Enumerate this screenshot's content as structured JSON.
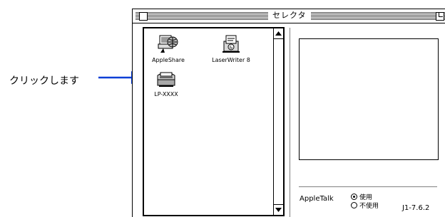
{
  "callout": {
    "text": "クリックします"
  },
  "window": {
    "title": "セレクタ",
    "devices": [
      {
        "label": "AppleShare",
        "icon": "appleshare-icon"
      },
      {
        "label": "LaserWriter 8",
        "icon": "laserwriter-icon"
      },
      {
        "label": "LP-XXXX",
        "icon": "printer-icon"
      }
    ],
    "appletalk": {
      "label": "AppleTalk",
      "options": [
        {
          "label": "使用",
          "selected": true
        },
        {
          "label": "不使用",
          "selected": false
        }
      ]
    },
    "version": "J1-7.6.2"
  }
}
